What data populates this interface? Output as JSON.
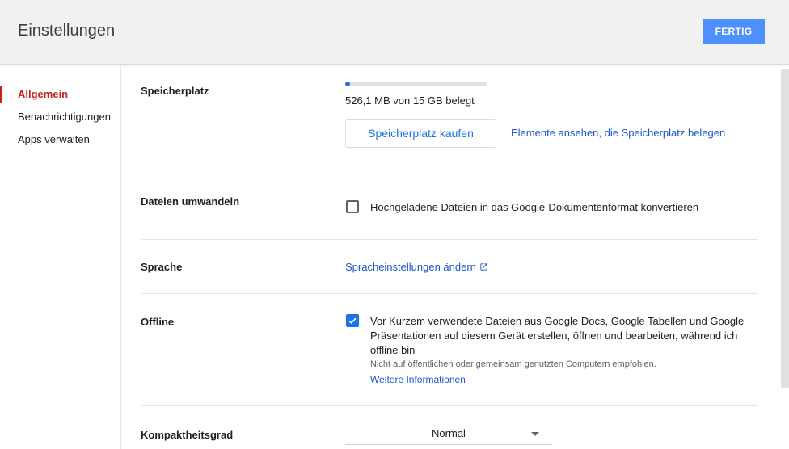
{
  "header": {
    "title": "Einstellungen",
    "done_label": "FERTIG"
  },
  "sidebar": {
    "items": [
      {
        "label": "Allgemein",
        "active": true
      },
      {
        "label": "Benachrichtigungen",
        "active": false
      },
      {
        "label": "Apps verwalten",
        "active": false
      }
    ]
  },
  "storage": {
    "label": "Speicherplatz",
    "usage_text": "526,1 MB von 15 GB belegt",
    "used_fraction": 0.034,
    "buy_label": "Speicherplatz kaufen",
    "view_items_link": "Elemente ansehen, die Speicherplatz belegen"
  },
  "convert": {
    "label": "Dateien umwandeln",
    "checkbox_text": "Hochgeladene Dateien in das Google-Dokumentenformat konvertieren",
    "checked": false
  },
  "language": {
    "label": "Sprache",
    "link_text": "Spracheinstellungen ändern"
  },
  "offline": {
    "label": "Offline",
    "checkbox_text": "Vor Kurzem verwendete Dateien aus Google Docs, Google Tabellen und Google Präsentationen auf diesem Gerät erstellen, öffnen und bearbeiten, während ich offline bin",
    "hint": "Nicht auf öffentlichen oder gemeinsam genutzten Computern empfohlen.",
    "more_info": "Weitere Informationen",
    "checked": true
  },
  "density": {
    "label": "Kompaktheitsgrad",
    "selected": "Normal"
  },
  "colors": {
    "accent": "#1a73e8",
    "done_button": "#4d90fe",
    "active_nav": "#c5221f"
  },
  "icons": {
    "external_link": "open-in-new-icon",
    "checkmark": "check-icon",
    "dropdown": "caret-down-icon"
  }
}
